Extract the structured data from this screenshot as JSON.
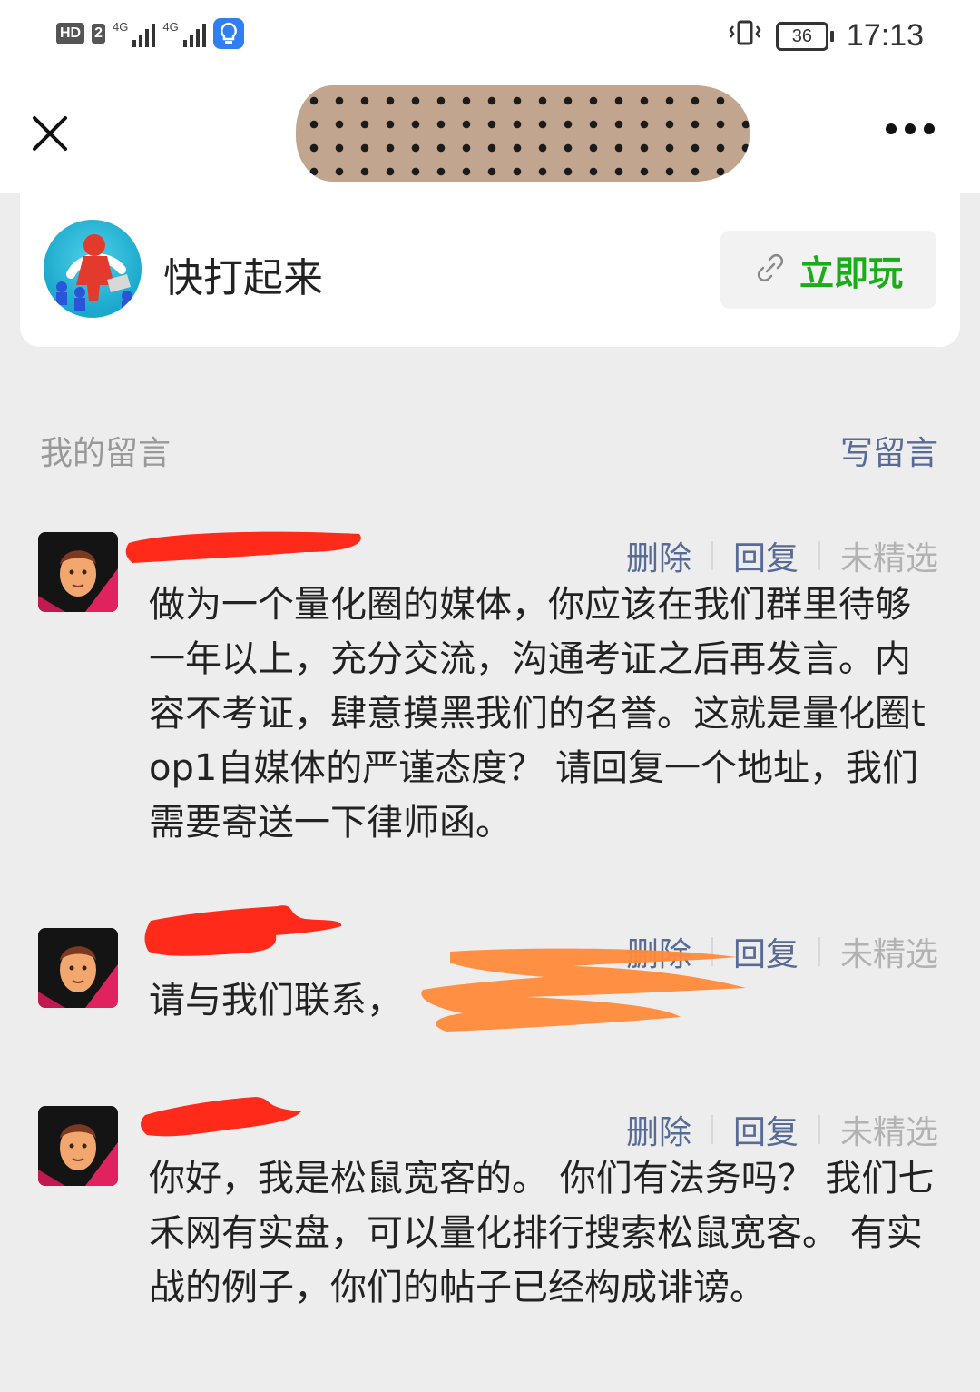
{
  "status_bar": {
    "hd": "HD",
    "sim": "2",
    "net1": "4G",
    "net2": "4G",
    "battery": "36",
    "time": "17:13"
  },
  "nav": {
    "close_icon": "close-x",
    "more_icon": "ellipsis"
  },
  "mini_app": {
    "name": "快打起来",
    "play_label": "立即玩",
    "play_icon": "link-icon"
  },
  "section": {
    "title": "我的留言",
    "write_label": "写留言"
  },
  "comments": [
    {
      "actions": {
        "delete": "删除",
        "reply": "回复",
        "status": "未精选"
      },
      "text": "做为一个量化圈的媒体，你应该在我们群里待够一年以上，充分交流，沟通考证之后再发言。内容不考证，肆意摸黑我们的名誉。这就是量化圈top1自媒体的严谨态度？ 请回复一个地址，我们需要寄送一下律师函。"
    },
    {
      "actions": {
        "delete": "删除",
        "reply": "回复",
        "status": "未精选"
      },
      "text": "请与我们联系，"
    },
    {
      "actions": {
        "delete": "删除",
        "reply": "回复",
        "status": "未精选"
      },
      "text": "你好，我是松鼠宽客的。 你们有法务吗？ 我们七禾网有实盘，可以量化排行搜索松鼠宽客。 有实战的例子，你们的帖子已经构成诽谤。"
    }
  ],
  "colors": {
    "link": "#576b95",
    "green": "#1aad19",
    "muted": "#999999",
    "background": "#ededed"
  }
}
